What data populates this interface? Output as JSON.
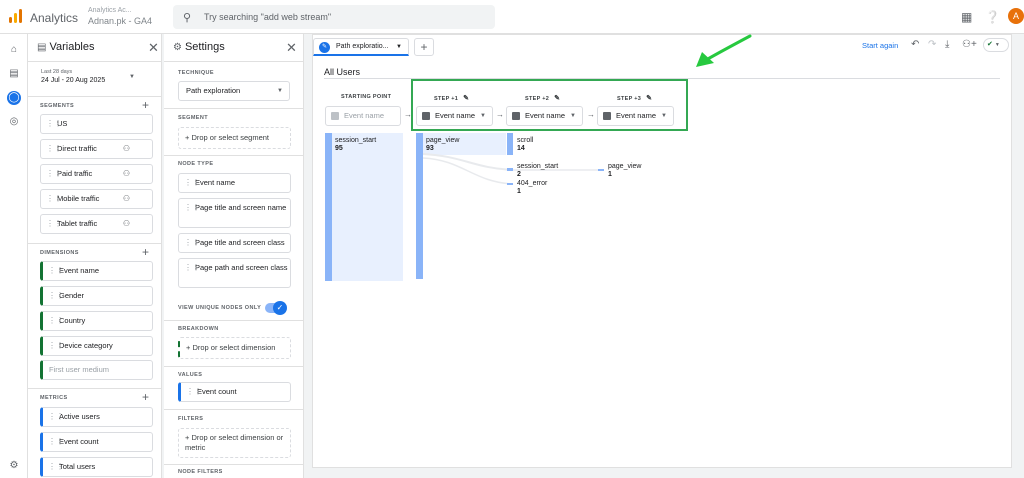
{
  "app": {
    "title": "Analytics",
    "account_line1": "Analytics Ac...",
    "account_line2": "Adnan.pk - GA4",
    "search_placeholder": "Try searching \"add web stream\"",
    "avatar_letter": "A"
  },
  "variables": {
    "title": "Variables",
    "date_label": "Last 28 days",
    "date_range": "24 Jul - 20 Aug 2025",
    "segments_header": "SEGMENTS",
    "segments": [
      "US",
      "Direct traffic",
      "Paid traffic",
      "Mobile traffic",
      "Tablet traffic"
    ],
    "dimensions_header": "DIMENSIONS",
    "dimensions": [
      "Event name",
      "Gender",
      "Country",
      "Device category",
      "First user medium"
    ],
    "metrics_header": "METRICS",
    "metrics": [
      "Active users",
      "Event count",
      "Total users"
    ]
  },
  "settings": {
    "title": "Settings",
    "technique_header": "TECHNIQUE",
    "technique_value": "Path exploration",
    "segment_header": "SEGMENT",
    "segment_drop": "+ Drop or select segment",
    "node_type_header": "NODE TYPE",
    "node_types": [
      "Event name",
      "Page title and screen name",
      "Page title and screen class",
      "Page path and screen class"
    ],
    "unique_nodes_label": "VIEW UNIQUE NODES ONLY",
    "breakdown_header": "BREAKDOWN",
    "breakdown_drop": "+ Drop or select dimension",
    "values_header": "VALUES",
    "values_item": "Event count",
    "filters_header": "FILTERS",
    "filters_drop": "+ Drop or select dimension or metric",
    "node_filters_header": "NODE FILTERS"
  },
  "canvas": {
    "tab_label": "Path exploratio...",
    "start_again": "Start again",
    "section_title": "All Users",
    "starting_point_header": "STARTING POINT",
    "starting_point_placeholder": "Event name",
    "steps": [
      {
        "header": "STEP +1",
        "value": "Event name"
      },
      {
        "header": "STEP +2",
        "value": "Event name"
      },
      {
        "header": "STEP +3",
        "value": "Event name"
      }
    ],
    "nodes": {
      "start": {
        "name": "session_start",
        "count": "95"
      },
      "step1": {
        "name": "page_view",
        "count": "93"
      },
      "step2": [
        {
          "name": "scroll",
          "count": "14"
        },
        {
          "name": "session_start",
          "count": "2"
        },
        {
          "name": "404_error",
          "count": "1"
        }
      ],
      "step3": {
        "name": "page_view",
        "count": "1"
      }
    }
  },
  "colors": {
    "accent": "#1a73e8",
    "highlight": "#34a853",
    "node_bar": "#8ab4f8"
  }
}
